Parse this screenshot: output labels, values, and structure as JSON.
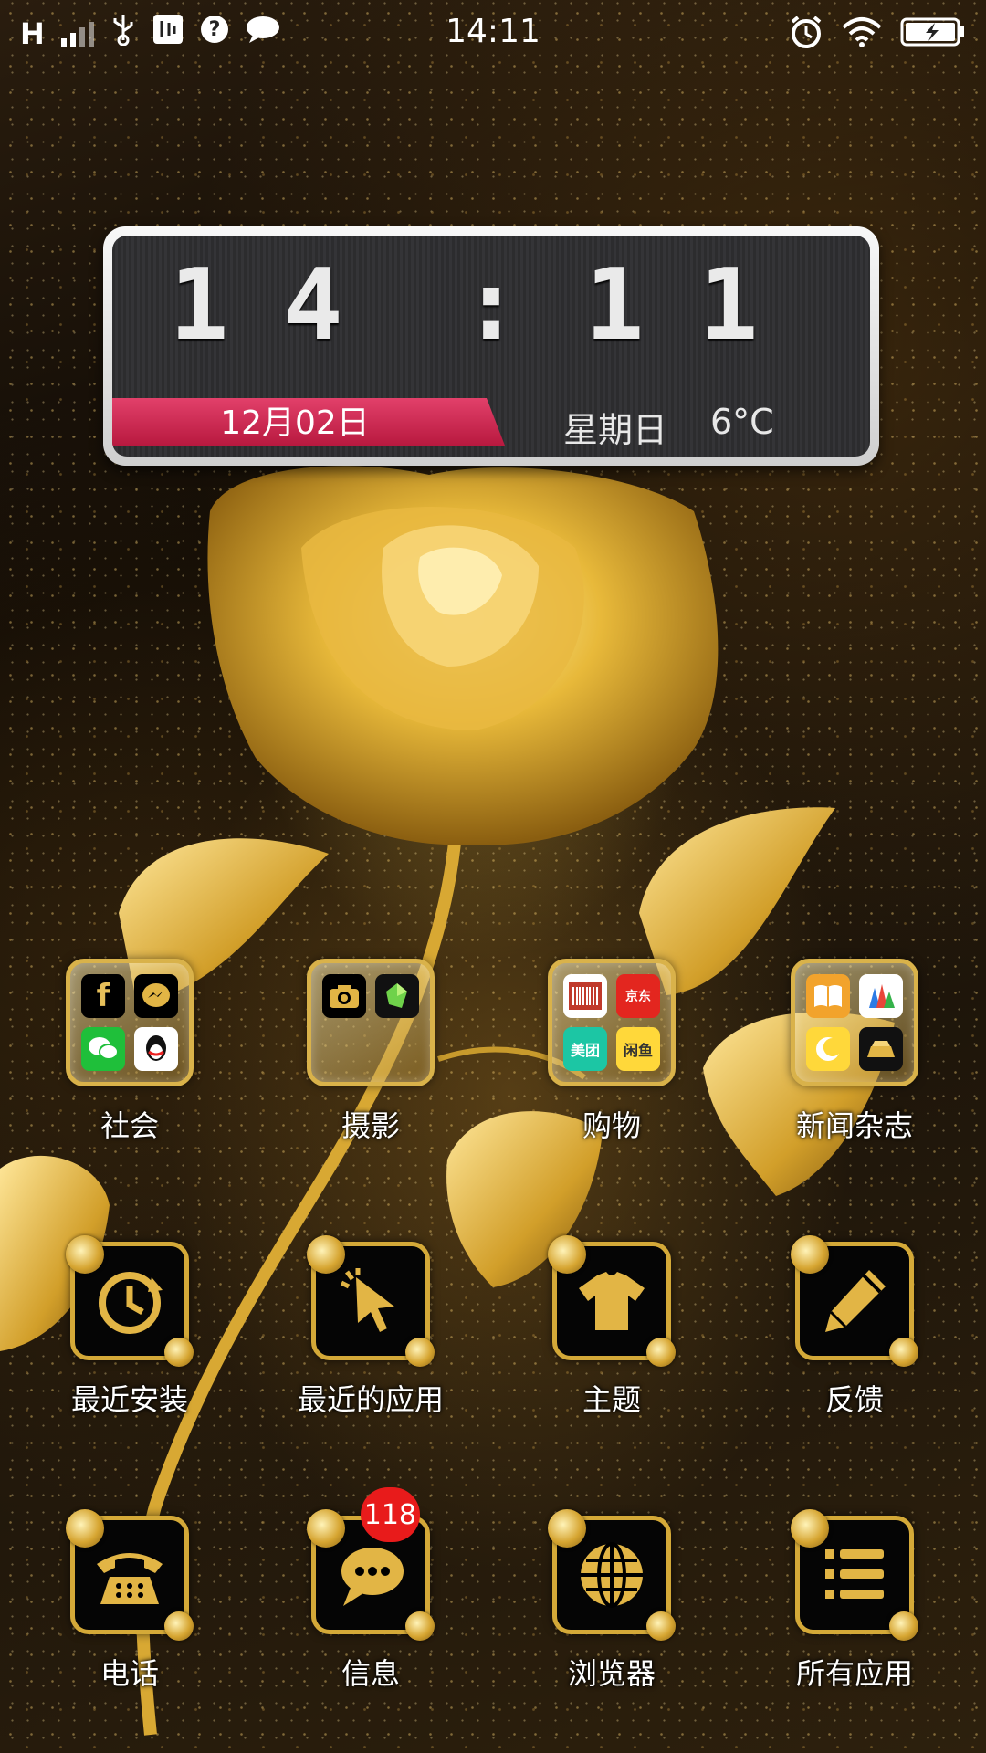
{
  "status_bar": {
    "network": "H",
    "time": "14:11"
  },
  "clock_widget": {
    "hour": "14",
    "minute": "11",
    "date": "12月02日",
    "weekday": "星期日",
    "temperature": "6°C"
  },
  "folders": [
    {
      "label": "社会",
      "apps": [
        "facebook-icon",
        "messenger-icon",
        "wechat-icon",
        "qq-icon"
      ]
    },
    {
      "label": "摄影",
      "apps": [
        "camera-icon",
        "photo-editor-icon"
      ]
    },
    {
      "label": "购物",
      "apps": [
        "barcode-icon",
        "jd-icon",
        "meituan-icon",
        "xianyu-icon"
      ],
      "mini_text": {
        "jd": "京东",
        "meituan": "美团",
        "xianyu": "闲鱼"
      }
    },
    {
      "label": "新闻杂志",
      "apps": [
        "book-icon",
        "news-icon",
        "moon-icon",
        "gold-icon"
      ]
    }
  ],
  "apps_row2": [
    {
      "label": "最近安装",
      "icon": "recent-install-icon"
    },
    {
      "label": "最近的应用",
      "icon": "cursor-icon"
    },
    {
      "label": "主题",
      "icon": "tshirt-icon"
    },
    {
      "label": "反馈",
      "icon": "pencil-icon"
    }
  ],
  "dock": [
    {
      "label": "电话",
      "icon": "phone-icon"
    },
    {
      "label": "信息",
      "icon": "message-icon",
      "badge": "118"
    },
    {
      "label": "浏览器",
      "icon": "globe-icon"
    },
    {
      "label": "所有应用",
      "icon": "list-icon"
    }
  ],
  "colors": {
    "gold": "#d4a938",
    "badge_red": "#e81b1b",
    "ribbon_pink": "#d6305a"
  }
}
